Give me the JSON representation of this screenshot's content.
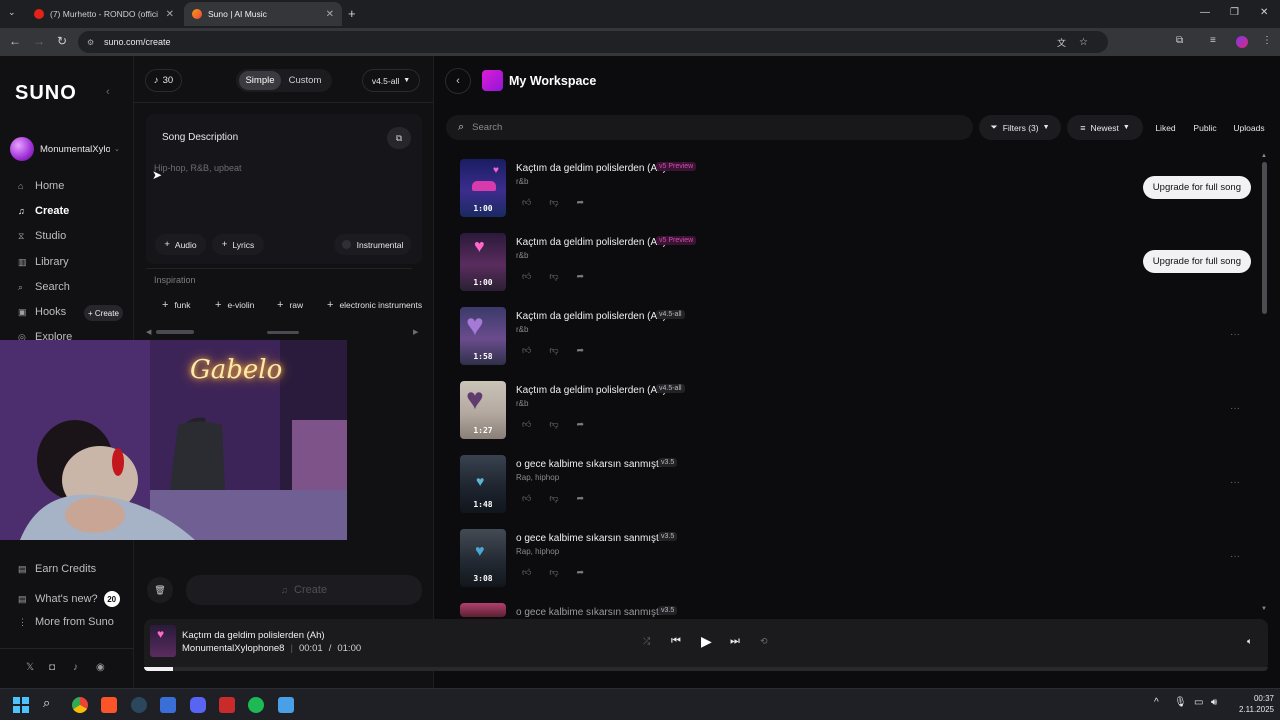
{
  "browser": {
    "tabs": [
      {
        "label": "(7) Murhetto - RONDO (official",
        "active": false
      },
      {
        "label": "Suno | AI Music",
        "active": true
      }
    ],
    "url": "suno.com/create"
  },
  "sidebar": {
    "logo": "SUNO",
    "username": "MonumentalXylo",
    "items": [
      {
        "label": "Home",
        "icon": "home-icon"
      },
      {
        "label": "Create",
        "icon": "music-note-icon"
      },
      {
        "label": "Studio",
        "icon": "studio-icon"
      },
      {
        "label": "Library",
        "icon": "library-icon"
      },
      {
        "label": "Search",
        "icon": "search-icon"
      },
      {
        "label": "Hooks",
        "icon": "hooks-icon"
      },
      {
        "label": "Explore",
        "icon": "explore-icon"
      }
    ],
    "hooks_create": "+ Create",
    "bottom": [
      {
        "label": "Earn Credits",
        "icon": "credits-icon"
      },
      {
        "label": "What's new?",
        "icon": "news-icon",
        "badge": "20"
      },
      {
        "label": "More from Suno",
        "icon": "more-icon"
      }
    ]
  },
  "create_panel": {
    "credits": "30",
    "mode_tabs": [
      "Simple",
      "Custom"
    ],
    "active_mode": "Simple",
    "model": "v4.5-all",
    "song_description_label": "Song Description",
    "description_placeholder": "Hip-hop, R&B, upbeat",
    "add_audio": "Audio",
    "add_lyrics": "Lyrics",
    "instrumental": "Instrumental",
    "inspiration_label": "Inspiration",
    "inspiration_chips": [
      "funk",
      "e-violin",
      "raw",
      "electronic instruments"
    ],
    "create_button": "Create"
  },
  "workspace": {
    "title": "My Workspace",
    "search_placeholder": "Search",
    "filters": "Filters (3)",
    "sort": "Newest",
    "liked": "Liked",
    "public": "Public",
    "uploads": "Uploads",
    "songs": [
      {
        "title": "Kaçtım da geldim polislerden (Ah)",
        "version": "v5 Preview",
        "genre": "r&b",
        "duration": "1:00",
        "upgrade": "Upgrade for full song"
      },
      {
        "title": "Kaçtım da geldim polislerden (Ah)",
        "version": "v5 Preview",
        "genre": "r&b",
        "duration": "1:00",
        "upgrade": "Upgrade for full song"
      },
      {
        "title": "Kaçtım da geldim polislerden (Ah)",
        "version": "v4.5-all",
        "genre": "r&b",
        "duration": "1:58"
      },
      {
        "title": "Kaçtım da geldim polislerden (Ah)",
        "version": "v4.5-all",
        "genre": "r&b",
        "duration": "1:27"
      },
      {
        "title": "o gece kalbime sıkarsın sanmıştım",
        "version": "v3.5",
        "genre": "Rap, hiphop",
        "duration": "1:48"
      },
      {
        "title": "o gece kalbime sıkarsın sanmıştım",
        "version": "v3.5",
        "genre": "Rap, hiphop",
        "duration": "3:08"
      },
      {
        "title": "o gece kalbime sıkarsın sanmıştım",
        "version": "v3.5",
        "genre": "",
        "duration": ""
      }
    ]
  },
  "player": {
    "title": "Kaçtım da geldim polislerden (Ah)",
    "artist": "MonumentalXylophone8",
    "current_time": "00:01",
    "separator": "/",
    "total_time": "01:00",
    "progress": 0.02
  },
  "webcam": {
    "neon_sign": "Gabelo"
  },
  "taskbar": {
    "time": "00:37",
    "date": "2.11.2025"
  },
  "colors": {
    "accent_pink": "#d14bb2",
    "workspace_icon": "#c026d3"
  }
}
